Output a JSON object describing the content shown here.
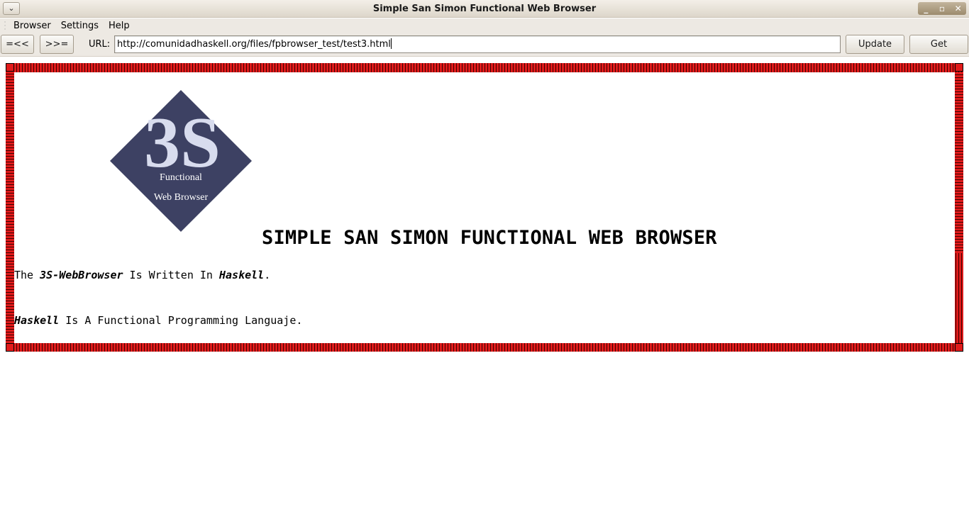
{
  "window": {
    "title": "Simple San Simon Functional Web Browser",
    "menu_button_glyph": "⌄",
    "controls": [
      "_",
      "▫",
      "✕"
    ]
  },
  "menubar": {
    "items": [
      "Browser",
      "Settings",
      "Help"
    ]
  },
  "toolbar": {
    "back_label": "=<<",
    "forward_label": ">>=",
    "url_label": "URL:",
    "url_value": "http://comunidadhaskell.org/files/fpbrowser_test/test3.html",
    "update_label": "Update",
    "get_label": "Get"
  },
  "page": {
    "logo": {
      "big_text": "3S",
      "line1": "Functional",
      "line2": "Web Browser"
    },
    "heading": "SIMPLE SAN SIMON FUNCTIONAL WEB BROWSER",
    "para1": {
      "pre": "The ",
      "em1": "3S-WebBrowser",
      "mid": " Is Written In ",
      "em2": "Haskell",
      "post": "."
    },
    "para2": {
      "em": "Haskell",
      "post": " Is A Functional Programming Languaje."
    }
  },
  "colors": {
    "frame_red": "#e11b1b",
    "logo_diamond": "#3d4163",
    "logo_text": "#d8dcee"
  }
}
